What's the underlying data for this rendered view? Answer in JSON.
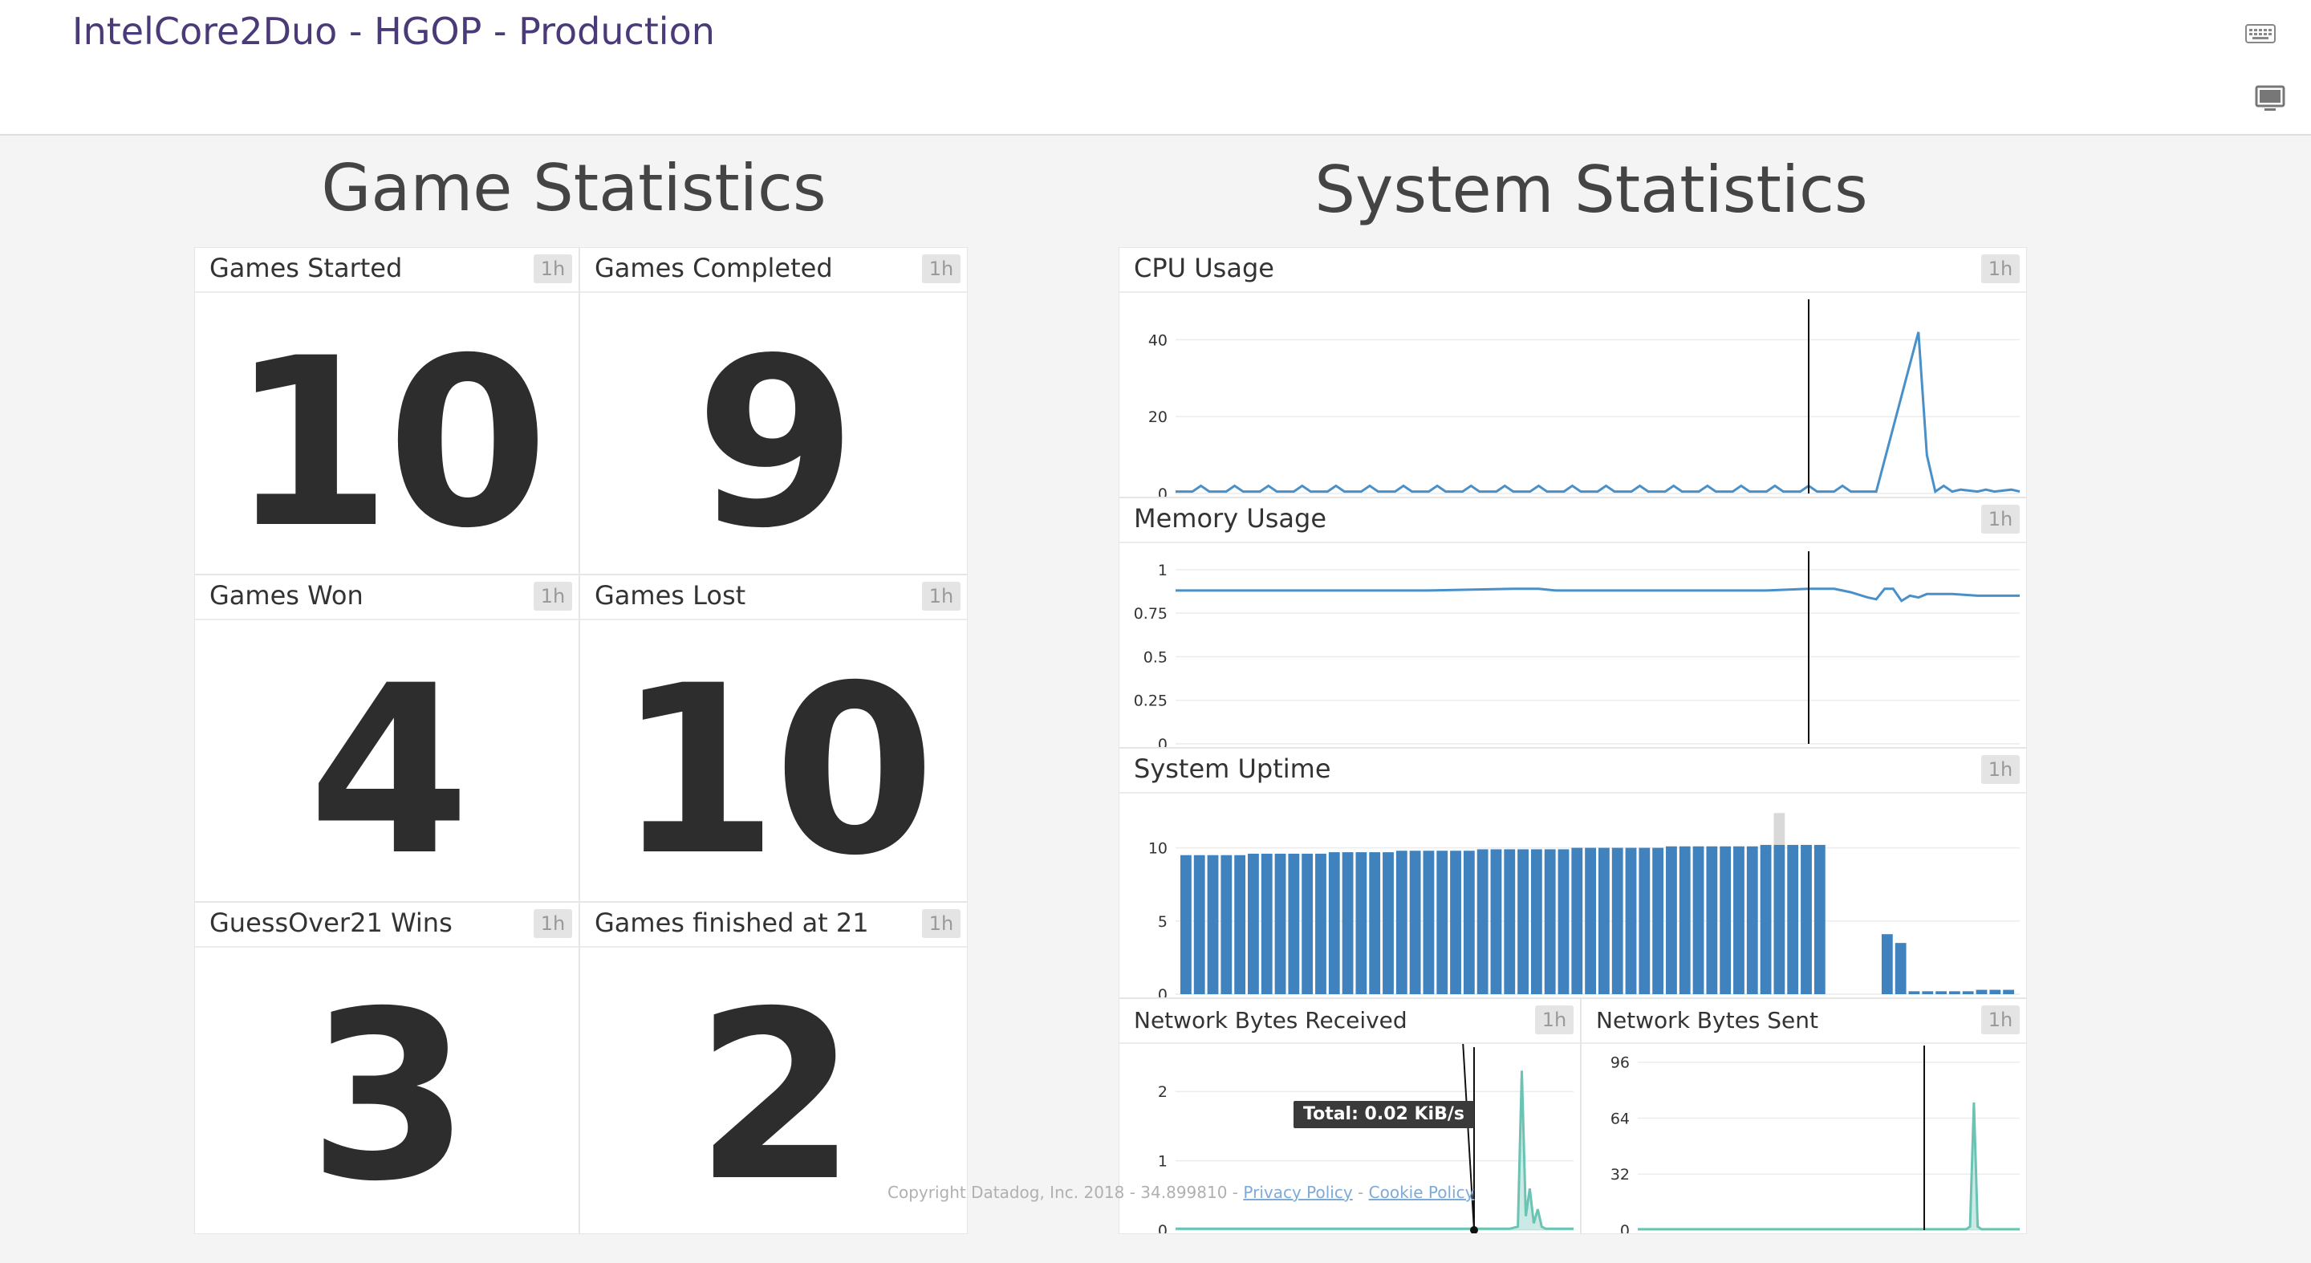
{
  "header": {
    "title": "IntelCore2Duo - HGOP - Production",
    "keyboard_icon": "keyboard-icon",
    "tv_mode_icon": "monitor-icon"
  },
  "sections": {
    "game": "Game Statistics",
    "system": "System Statistics"
  },
  "game_stats": [
    {
      "title": "Games Started",
      "timeframe": "1h",
      "value": "10"
    },
    {
      "title": "Games Completed",
      "timeframe": "1h",
      "value": "9"
    },
    {
      "title": "Games Won",
      "timeframe": "1h",
      "value": "4"
    },
    {
      "title": "Games Lost",
      "timeframe": "1h",
      "value": "10"
    },
    {
      "title": "GuessOver21 Wins",
      "timeframe": "1h",
      "value": "3"
    },
    {
      "title": "Games finished at 21",
      "timeframe": "1h",
      "value": "2"
    }
  ],
  "system_widgets": {
    "cpu": {
      "title": "CPU Usage",
      "timeframe": "1h"
    },
    "memory": {
      "title": "Memory Usage",
      "timeframe": "1h"
    },
    "uptime": {
      "title": "System Uptime",
      "timeframe": "1h"
    },
    "net_rx": {
      "title": "Network Bytes Received",
      "timeframe": "1h",
      "tooltip": "Total: 0.02 KiB/s"
    },
    "net_tx": {
      "title": "Network Bytes Sent",
      "timeframe": "1h"
    }
  },
  "footer": {
    "copyright": "Copyright Datadog, Inc. 2018 - 34.899810 - ",
    "privacy": "Privacy Policy",
    "sep": " - ",
    "cookie": "Cookie Policy"
  },
  "chart_data": [
    {
      "type": "line",
      "title": "CPU Usage",
      "ylim": [
        0,
        48
      ],
      "yticks": [
        "0",
        "20",
        "40"
      ],
      "color": "#4a90c8",
      "x": [
        0,
        2,
        3,
        4,
        6,
        7,
        8,
        10,
        11,
        12,
        14,
        15,
        16,
        18,
        19,
        20,
        22,
        23,
        24,
        26,
        27,
        28,
        30,
        31,
        32,
        34,
        35,
        36,
        38,
        39,
        40,
        42,
        43,
        44,
        46,
        47,
        48,
        50,
        51,
        52,
        54,
        55,
        56,
        58,
        59,
        60,
        62,
        63,
        64,
        66,
        67,
        68,
        70,
        71,
        72,
        74,
        75,
        76,
        78,
        79,
        80,
        83,
        88,
        89,
        90,
        91,
        92,
        93,
        95,
        96,
        97,
        99,
        100
      ],
      "values": [
        0.5,
        0.5,
        2,
        0.5,
        0.5,
        2,
        0.5,
        0.5,
        2,
        0.5,
        0.5,
        2,
        0.5,
        0.5,
        2,
        0.5,
        0.5,
        2,
        0.5,
        0.5,
        2,
        0.5,
        0.5,
        2,
        0.5,
        0.5,
        2,
        0.5,
        0.5,
        2,
        0.5,
        0.5,
        2,
        0.5,
        0.5,
        2,
        0.5,
        0.5,
        2,
        0.5,
        0.5,
        2,
        0.5,
        0.5,
        2,
        0.5,
        0.5,
        2,
        0.5,
        0.5,
        2,
        0.5,
        0.5,
        2,
        0.5,
        0.5,
        2,
        0.5,
        0.5,
        2,
        0.5,
        0.5,
        42,
        10,
        0.5,
        2,
        0.5,
        1,
        0.5,
        1,
        0.5,
        1,
        0.5
      ],
      "cursor_x": 75
    },
    {
      "type": "line",
      "title": "Memory Usage",
      "ylim": [
        0,
        1.05
      ],
      "yticks": [
        "0",
        "0.25",
        "0.5",
        "0.75",
        "1"
      ],
      "color": "#4a90c8",
      "x": [
        0,
        10,
        20,
        30,
        40,
        43,
        45,
        55,
        65,
        70,
        75,
        78,
        80,
        82,
        83,
        84,
        85,
        86,
        87,
        88,
        89,
        90,
        92,
        95,
        98,
        100
      ],
      "values": [
        0.88,
        0.88,
        0.88,
        0.88,
        0.89,
        0.89,
        0.88,
        0.88,
        0.88,
        0.88,
        0.89,
        0.89,
        0.87,
        0.84,
        0.83,
        0.89,
        0.89,
        0.82,
        0.85,
        0.84,
        0.86,
        0.86,
        0.86,
        0.85,
        0.85,
        0.85
      ],
      "cursor_x": 75
    },
    {
      "type": "bar",
      "title": "System Uptime",
      "ylim": [
        0,
        12.5
      ],
      "yticks": [
        "0",
        "5",
        "10"
      ],
      "color": "#3f82bd",
      "values": [
        9.5,
        9.5,
        9.5,
        9.5,
        9.5,
        9.6,
        9.6,
        9.6,
        9.6,
        9.6,
        9.6,
        9.7,
        9.7,
        9.7,
        9.7,
        9.7,
        9.8,
        9.8,
        9.8,
        9.8,
        9.8,
        9.8,
        9.9,
        9.9,
        9.9,
        9.9,
        9.9,
        9.9,
        9.9,
        10,
        10,
        10,
        10,
        10,
        10,
        10,
        10.1,
        10.1,
        10.1,
        10.1,
        10.1,
        10.1,
        10.1,
        10.2,
        10.2,
        10.2,
        10.2,
        10.2,
        0,
        0,
        0,
        0,
        4.1,
        3.5,
        0.2,
        0.2,
        0.2,
        0.2,
        0.2,
        0.3,
        0.3,
        0.3
      ],
      "highlight_index": 44
    },
    {
      "type": "area",
      "title": "Network Bytes Received",
      "ylim": [
        0,
        2.5
      ],
      "yticks": [
        "0",
        "1",
        "2"
      ],
      "color": "#6bc3b4",
      "x": [
        0,
        20,
        40,
        60,
        80,
        84,
        86,
        87,
        88,
        89,
        90,
        91,
        92,
        93,
        94,
        100
      ],
      "values": [
        0.02,
        0.02,
        0.02,
        0.02,
        0.02,
        0.02,
        0.05,
        2.3,
        0.2,
        0.6,
        0.1,
        0.3,
        0.05,
        0.02,
        0.02,
        0.02
      ],
      "cursor_x": 75
    },
    {
      "type": "area",
      "title": "Network Bytes Sent",
      "ylim": [
        0,
        100
      ],
      "yticks": [
        "0",
        "32",
        "64",
        "96"
      ],
      "color": "#6bc3b4",
      "x": [
        0,
        20,
        40,
        60,
        80,
        86,
        87,
        88,
        89,
        90,
        100
      ],
      "values": [
        0.5,
        0.5,
        0.5,
        0.5,
        0.5,
        0.5,
        2,
        73,
        2,
        0.5,
        0.5
      ],
      "cursor_x": 75
    }
  ]
}
